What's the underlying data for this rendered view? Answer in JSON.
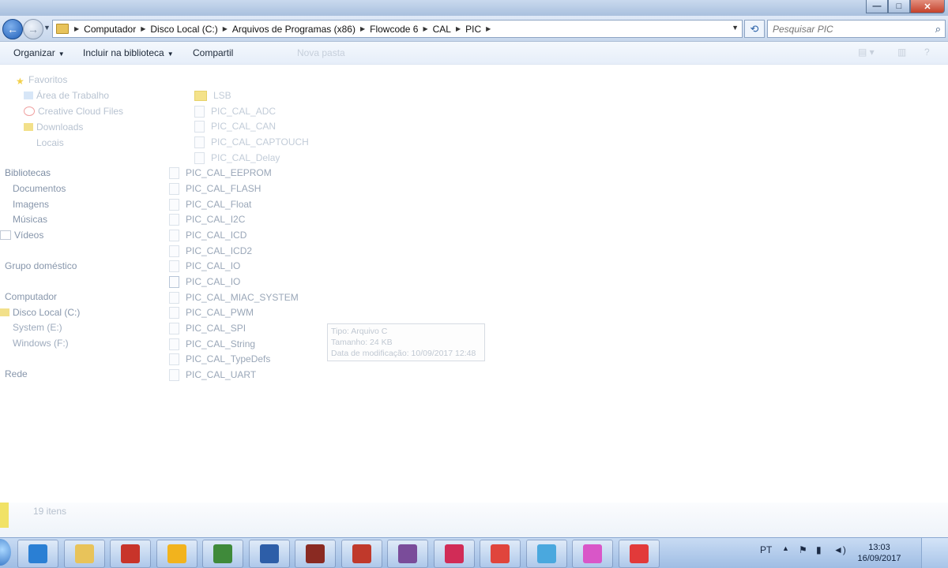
{
  "window": {
    "minimize_label": "—",
    "maximize_label": "□",
    "close_label": "✕"
  },
  "address": {
    "back_icon": "back-arrow-icon",
    "forward_icon": "forward-arrow-icon",
    "breadcrumbs": [
      "Computador",
      "Disco Local (C:)",
      "Arquivos de Programas (x86)",
      "Flowcode 6",
      "CAL",
      "PIC"
    ]
  },
  "search": {
    "placeholder": "Pesquisar PIC"
  },
  "toolbar": {
    "organize": "Organizar",
    "include_library": "Incluir na biblioteca",
    "share": "Compartil",
    "new_folder": "Nova pasta"
  },
  "nav": {
    "favorites": "Favoritos",
    "desktop": "Área de Trabalho",
    "creative_cloud": "Creative Cloud Files",
    "downloads": "Downloads",
    "locais": "Locais",
    "libraries": "Bibliotecas",
    "documents": "Documentos",
    "images": "Imagens",
    "music": "Músicas",
    "videos": "Vídeos",
    "homegroup": "Grupo doméstico",
    "computer": "Computador",
    "disk_c": "Disco Local (C:)",
    "disk_e": "System (E:)",
    "disk_f": "Windows (F:)",
    "network": "Rede"
  },
  "files": [
    {
      "name": "LSB",
      "type": "folder"
    },
    {
      "name": "PIC_CAL_ADC",
      "type": "file"
    },
    {
      "name": "PIC_CAL_CAN",
      "type": "file"
    },
    {
      "name": "PIC_CAL_CAPTOUCH",
      "type": "file"
    },
    {
      "name": "PIC_CAL_Delay",
      "type": "file"
    },
    {
      "name": "PIC_CAL_EEPROM",
      "type": "file"
    },
    {
      "name": "PIC_CAL_FLASH",
      "type": "file"
    },
    {
      "name": "PIC_CAL_Float",
      "type": "file"
    },
    {
      "name": "PIC_CAL_I2C",
      "type": "file"
    },
    {
      "name": "PIC_CAL_ICD",
      "type": "file"
    },
    {
      "name": "PIC_CAL_ICD2",
      "type": "file"
    },
    {
      "name": "PIC_CAL_IO",
      "type": "file"
    },
    {
      "name": "PIC_CAL_IO",
      "type": "file-alt"
    },
    {
      "name": "PIC_CAL_MIAC_SYSTEM",
      "type": "file"
    },
    {
      "name": "PIC_CAL_PWM",
      "type": "file"
    },
    {
      "name": "PIC_CAL_SPI",
      "type": "file"
    },
    {
      "name": "PIC_CAL_String",
      "type": "file"
    },
    {
      "name": "PIC_CAL_TypeDefs",
      "type": "file"
    },
    {
      "name": "PIC_CAL_UART",
      "type": "file"
    }
  ],
  "tooltip": {
    "type": "Tipo: Arquivo C",
    "size": "Tamanho: 24 KB",
    "modified": "Data de modificação: 10/09/2017 12:48"
  },
  "status": {
    "item_count": "19 itens"
  },
  "taskbar": {
    "apps": [
      {
        "icon": "internet-explorer-icon",
        "color": "#2a7fd4"
      },
      {
        "icon": "file-explorer-icon",
        "color": "#e8c35a"
      },
      {
        "icon": "tool-app-icon",
        "color": "#c8342a"
      },
      {
        "icon": "media-player-icon",
        "color": "#f2b31d"
      },
      {
        "icon": "network-app-icon",
        "color": "#3f8a3a"
      },
      {
        "icon": "network-share-icon",
        "color": "#2d5ea8"
      },
      {
        "icon": "flowcode-icon",
        "color": "#8a2a22"
      },
      {
        "icon": "pdf-reader-icon",
        "color": "#c0392b"
      },
      {
        "icon": "winrar-icon",
        "color": "#7a4c9a"
      },
      {
        "icon": "ic-app-icon",
        "color": "#d12c57"
      },
      {
        "icon": "ic-app-2-icon",
        "color": "#e0453c"
      },
      {
        "icon": "dvd-app-icon",
        "color": "#4aa8de"
      },
      {
        "icon": "graphics-app-icon",
        "color": "#d956c8"
      },
      {
        "icon": "recorder-app-icon",
        "color": "#e23a3a"
      }
    ],
    "language": "PT",
    "time": "13:03",
    "date": "16/09/2017"
  }
}
